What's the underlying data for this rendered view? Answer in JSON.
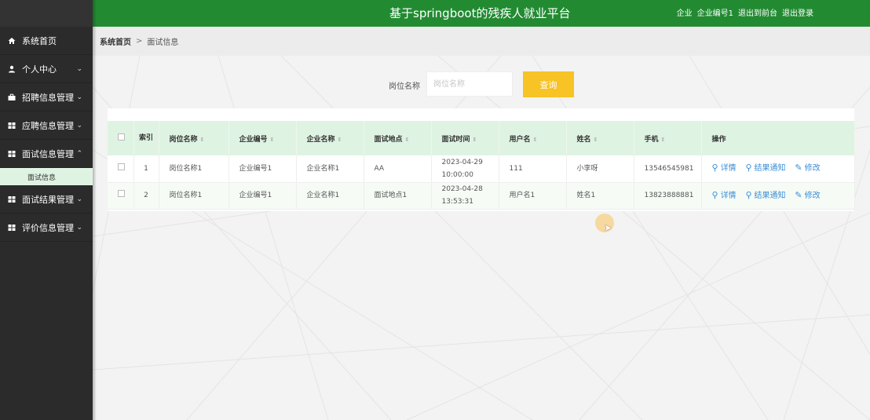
{
  "header": {
    "title": "基于springboot的残疾人就业平台",
    "user_role": "企业",
    "user_name": "企业编号1",
    "to_front_label": "退出到前台",
    "logout_label": "退出登录"
  },
  "sidebar": {
    "items": [
      {
        "label": "系统首页",
        "icon": "home-icon"
      },
      {
        "label": "个人中心",
        "icon": "user-icon"
      },
      {
        "label": "招聘信息管理",
        "icon": "briefcase-icon"
      },
      {
        "label": "应聘信息管理",
        "icon": "grid-icon"
      },
      {
        "label": "面试信息管理",
        "icon": "grid-icon"
      },
      {
        "label": "面试结果管理",
        "icon": "grid-icon"
      },
      {
        "label": "评价信息管理",
        "icon": "grid-icon"
      }
    ],
    "sub_item": "面试信息"
  },
  "breadcrumb": {
    "home": "系统首页",
    "separator": ">",
    "current": "面试信息"
  },
  "search": {
    "label": "岗位名称",
    "placeholder": "岗位名称",
    "value": "",
    "button": "查询"
  },
  "table": {
    "headers": {
      "index": "索引",
      "job_name": "岗位名称",
      "company_no": "企业编号",
      "company_name": "企业名称",
      "location": "面试地点",
      "time": "面试时间",
      "username": "用户名",
      "name": "姓名",
      "phone": "手机",
      "actions": "操作"
    },
    "rows": [
      {
        "index": "1",
        "job_name": "岗位名称1",
        "company_no": "企业编号1",
        "company_name": "企业名称1",
        "location": "AA",
        "time": "2023-04-29 10:00:00",
        "username": "111",
        "name": "小李呀",
        "phone": "13546545981"
      },
      {
        "index": "2",
        "job_name": "岗位名称1",
        "company_no": "企业编号1",
        "company_name": "企业名称1",
        "location": "面试地点1",
        "time": "2023-04-28 13:53:31",
        "username": "用户名1",
        "name": "姓名1",
        "phone": "13823888881"
      }
    ],
    "actions": {
      "detail": "详情",
      "notify": "结果通知",
      "edit": "修改"
    }
  },
  "colors": {
    "header_bg": "#228b32",
    "sidebar_bg": "#2b2b2b",
    "accent_button": "#f7c325",
    "table_header_bg": "#dff3e3",
    "link": "#3b8ed6"
  }
}
